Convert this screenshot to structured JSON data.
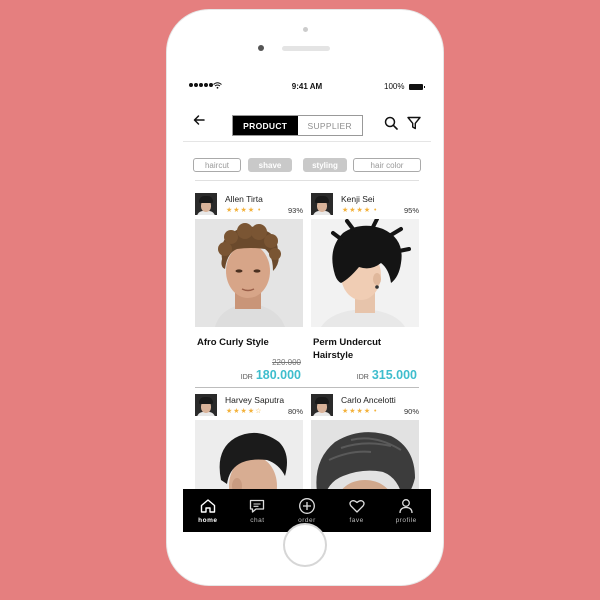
{
  "status": {
    "time": "9:41 AM",
    "battery": "100%"
  },
  "nav": {
    "tabs": [
      {
        "label": "PRODUCT",
        "active": true
      },
      {
        "label": "SUPPLIER",
        "active": false
      }
    ]
  },
  "chips": [
    {
      "label": "haircut",
      "selected": false
    },
    {
      "label": "shave",
      "selected": true
    },
    {
      "label": "styling",
      "selected": true
    },
    {
      "label": "hair color",
      "selected": false
    }
  ],
  "products": [
    {
      "seller": "Allen Tirta",
      "stars": 4,
      "rating": "93%",
      "title": "Afro Curly Style",
      "old_price": "220.000",
      "currency": "IDR",
      "price": "180.000"
    },
    {
      "seller": "Kenji Sei",
      "stars": 4,
      "rating": "95%",
      "title": "Perm Undercut Hairstyle",
      "old_price": "",
      "currency": "IDR",
      "price": "315.000"
    },
    {
      "seller": "Harvey Saputra",
      "stars": 4,
      "rating": "80%"
    },
    {
      "seller": "Carlo Ancelotti",
      "stars": 4,
      "rating": "90%"
    }
  ],
  "tabbar": [
    {
      "label": "home",
      "icon": "home-icon",
      "active": true
    },
    {
      "label": "chat",
      "icon": "chat-icon",
      "active": false
    },
    {
      "label": "order",
      "icon": "order-plus-icon",
      "active": false
    },
    {
      "label": "fave",
      "icon": "heart-icon",
      "active": false
    },
    {
      "label": "profile",
      "icon": "profile-icon",
      "active": false
    }
  ],
  "colors": {
    "background": "#e57f7f",
    "price": "#3ebdcd",
    "star": "#f3b23c",
    "tabbar": "#000000"
  }
}
